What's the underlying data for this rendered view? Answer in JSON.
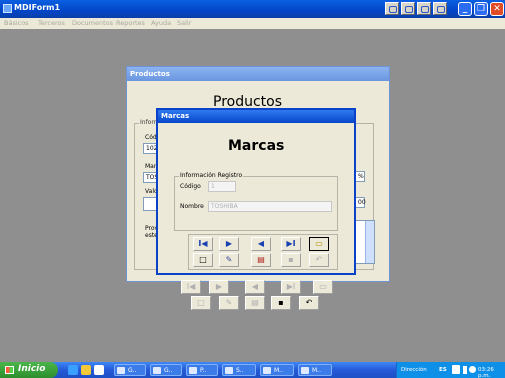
{
  "window": {
    "title": "MDIForm1"
  },
  "menu": [
    "Básicos",
    "Terceros",
    "Documentos",
    "Reportes",
    "Ayuda",
    "Salir"
  ],
  "productos": {
    "title": "Productos",
    "heading": "Productos",
    "fieldset_legend": "Inform",
    "codigo_label": "Cód",
    "codigo_value": "102",
    "marca_label": "Marc",
    "marca_value": "TOS",
    "valor_label": "Valo",
    "valor_value": "",
    "right_value_1": "%",
    "right_value_2": "00",
    "proveedor_label": "Prov\neste",
    "nav_first": "I◀",
    "nav_next": "▶",
    "nav_prev": "◀",
    "nav_last": "▶I",
    "nav_new": "□"
  },
  "marcas": {
    "title": "Marcas",
    "heading": "Marcas",
    "fieldset_legend": "Información Registro",
    "codigo_label": "Código",
    "codigo_value": "1",
    "nombre_label": "Nombre",
    "nombre_value": "TOSHIBA"
  },
  "taskbar": {
    "start_label": "Inicio",
    "items": [
      "G..",
      "G..",
      "P..",
      "S..",
      "M..",
      "M.."
    ],
    "tray_direccion": "Dirección",
    "tray_lang": "ES",
    "tray_time": "03:26 p.m."
  }
}
